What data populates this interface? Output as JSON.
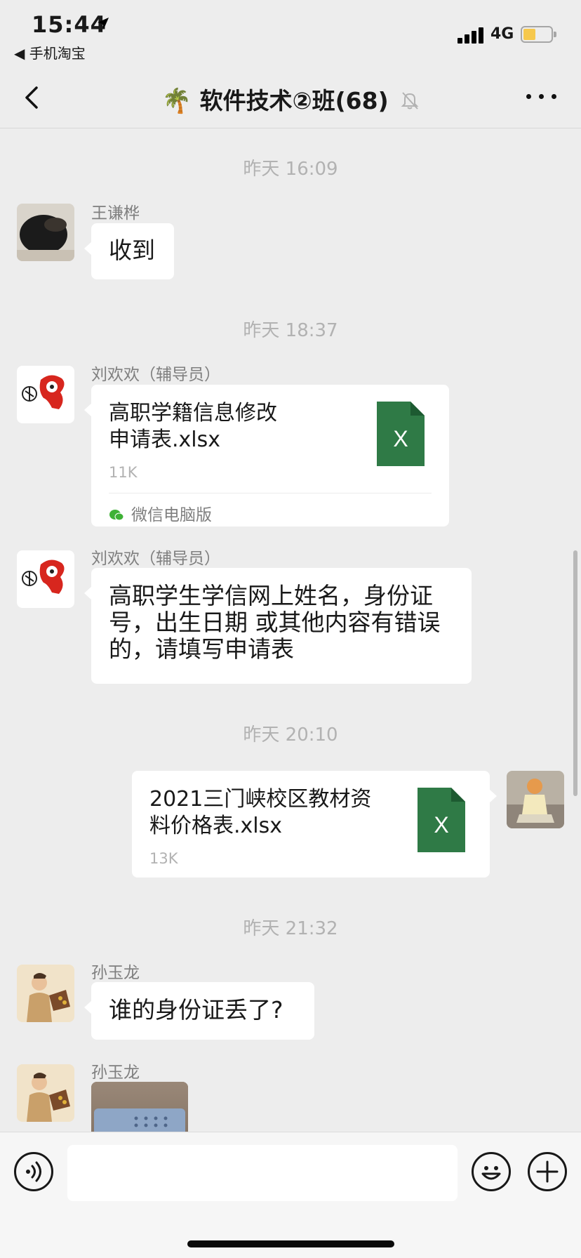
{
  "status_bar": {
    "time": "15:44",
    "location_icon": "location-arrow-icon",
    "back_to_app": "◀ 手机淘宝",
    "network": "4G",
    "battery_color": "#f6c84d"
  },
  "nav": {
    "title_emoji": "🌴",
    "title": "软件技术②班(68)",
    "back_icon": "chevron-left-icon",
    "mute_icon": "bell-slash-icon",
    "more_icon": "more-dots-icon"
  },
  "messages": {
    "ts1": "昨天 16:09",
    "m1": {
      "sender": "王谦桦",
      "text": "收到"
    },
    "ts2": "昨天 18:37",
    "m2": {
      "sender": "刘欢欢（辅导员）",
      "file_name_line1": "高职学籍信息修改",
      "file_name_line2": "申请表.xlsx",
      "file_size": "11K",
      "source": "微信电脑版",
      "file_letter": "X"
    },
    "m3": {
      "sender": "刘欢欢（辅导员）",
      "line1": "高职学生学信网上姓名，身份证",
      "line2": "号，出生日期 或其他内容有错误",
      "line3": "的，请填写申请表"
    },
    "ts3": "昨天 20:10",
    "m4": {
      "file_name_line1": "2021三门峡校区教材资",
      "file_name_line2": "料价格表.xlsx",
      "file_size": "13K",
      "file_letter": "X"
    },
    "ts4": "昨天 21:32",
    "m5": {
      "sender": "孙玉龙",
      "text": "谁的身份证丢了?"
    },
    "m6": {
      "sender": "孙玉龙"
    }
  },
  "input_bar": {
    "voice_icon": "voice-icon",
    "emoji_icon": "emoji-icon",
    "plus_icon": "plus-icon",
    "input_value": ""
  },
  "colors": {
    "background": "#ededed",
    "bubble": "#ffffff",
    "excel_green": "#2f7a46",
    "timestamp": "#b2b2b2"
  }
}
